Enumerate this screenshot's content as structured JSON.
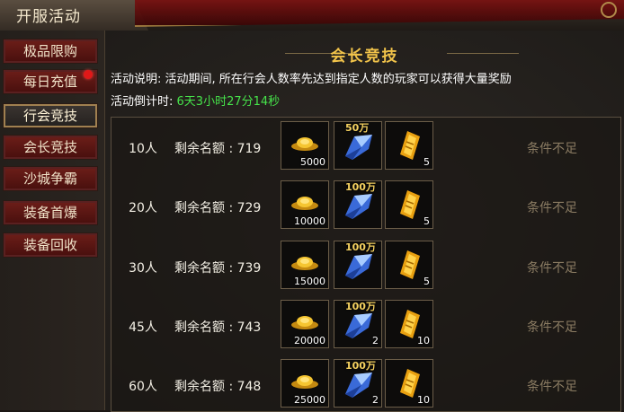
{
  "window": {
    "title": "开服活动"
  },
  "sidebar": {
    "items": [
      {
        "label": "极品限购",
        "active": false,
        "badge": false
      },
      {
        "label": "每日充值",
        "active": false,
        "badge": true
      },
      {
        "label": "行会竞技",
        "active": true,
        "badge": false
      },
      {
        "label": "会长竞技",
        "active": false,
        "badge": false
      },
      {
        "label": "沙城争霸",
        "active": false,
        "badge": false
      },
      {
        "label": "装备首爆",
        "active": false,
        "badge": false
      },
      {
        "label": "装备回收",
        "active": false,
        "badge": false
      }
    ]
  },
  "main": {
    "heading": "会长竞技",
    "heading_ornament": "— ◆ —",
    "description": "活动说明: 活动期间, 所在行会人数率先达到指定人数的玩家可以获得大量奖励",
    "countdown_label": "活动倒计时:",
    "countdown_value": "6天3小时27分14秒"
  },
  "rows": [
    {
      "people": "10人",
      "quota": "剩余名额 : 719",
      "ingot": "5000",
      "crystal_tag": "50万",
      "crystal_qty": "",
      "ticket_qty": "5",
      "status": "条件不足"
    },
    {
      "people": "20人",
      "quota": "剩余名额 : 729",
      "ingot": "10000",
      "crystal_tag": "100万",
      "crystal_qty": "",
      "ticket_qty": "5",
      "status": "条件不足"
    },
    {
      "people": "30人",
      "quota": "剩余名额 : 739",
      "ingot": "15000",
      "crystal_tag": "100万",
      "crystal_qty": "",
      "ticket_qty": "5",
      "status": "条件不足"
    },
    {
      "people": "45人",
      "quota": "剩余名额 : 743",
      "ingot": "20000",
      "crystal_tag": "100万",
      "crystal_qty": "2",
      "ticket_qty": "10",
      "status": "条件不足"
    },
    {
      "people": "60人",
      "quota": "剩余名额 : 748",
      "ingot": "25000",
      "crystal_tag": "100万",
      "crystal_qty": "2",
      "ticket_qty": "10",
      "status": "条件不足"
    }
  ],
  "colors": {
    "heading": "#f1c34a",
    "countdown": "#46e24a",
    "status_disabled": "#8a7b62",
    "button_red": "#6a1d18"
  },
  "icons": {
    "ingot": "gold-ingot-icon",
    "crystal": "blue-crystal-icon",
    "ticket": "gold-ticket-icon"
  }
}
